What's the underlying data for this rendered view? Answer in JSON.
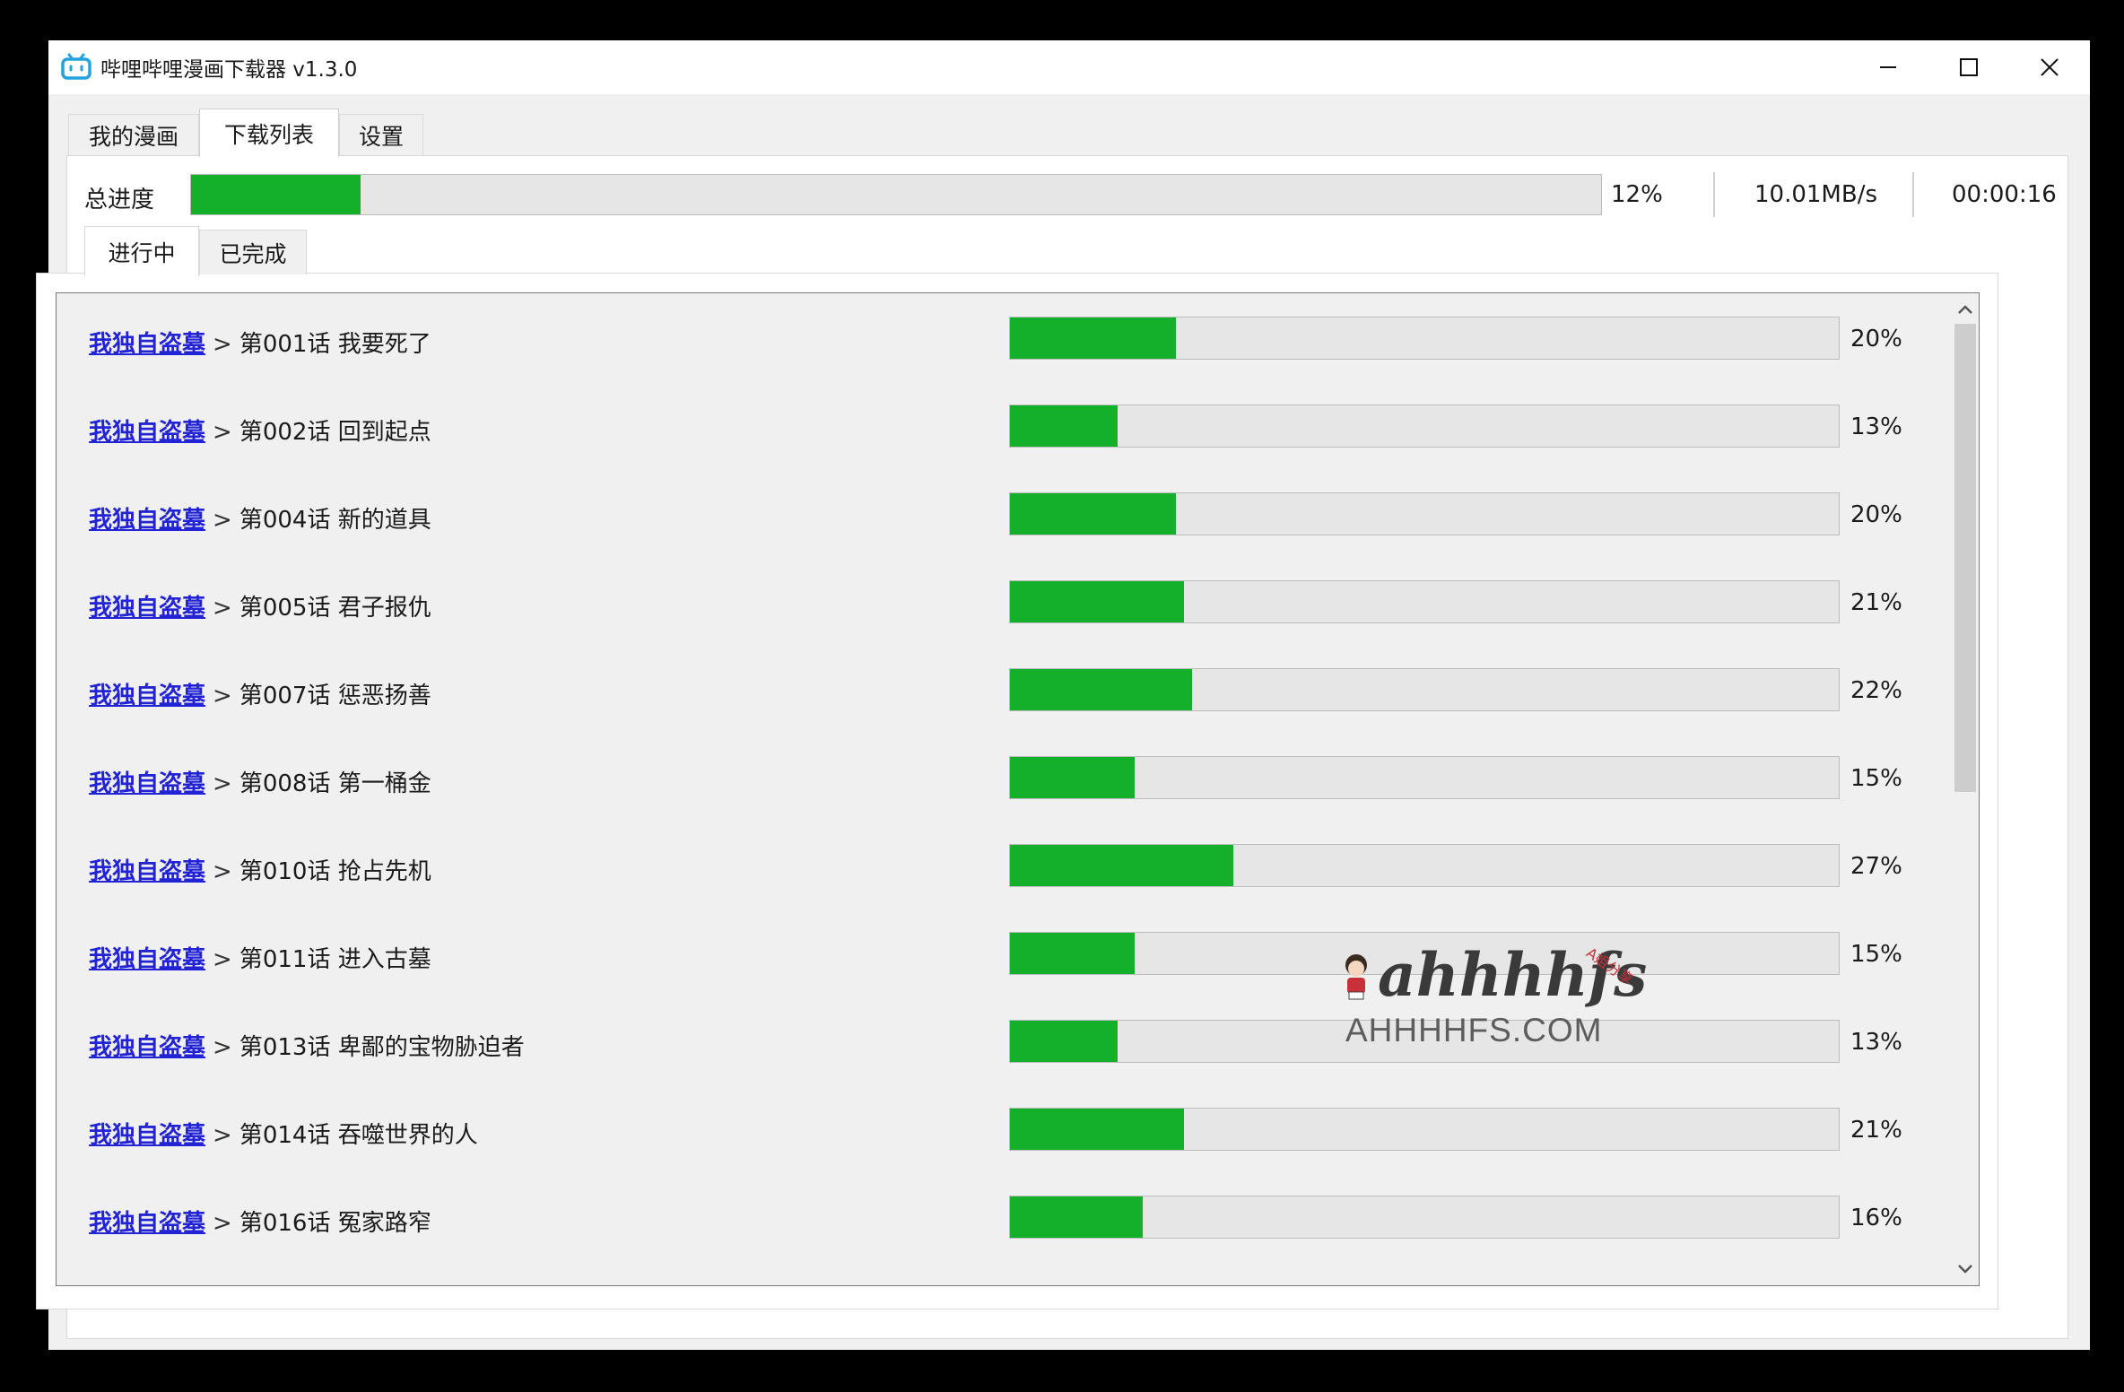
{
  "window": {
    "title": "哔哩哔哩漫画下载器 v1.3.0",
    "icon": "bilibili-tv-icon",
    "controls": {
      "minimize": "minimize-icon",
      "maximize": "maximize-icon",
      "close": "close-icon"
    }
  },
  "top_tabs": [
    {
      "label": "我的漫画",
      "active": false
    },
    {
      "label": "下载列表",
      "active": true
    },
    {
      "label": "设置",
      "active": false
    }
  ],
  "overall": {
    "label": "总进度",
    "progress": 12,
    "percent_text": "12%",
    "speed": "10.01MB/s",
    "elapsed": "00:00:16"
  },
  "sub_tabs": [
    {
      "label": "进行中",
      "active": true
    },
    {
      "label": "已完成",
      "active": false
    }
  ],
  "colors": {
    "progress_fill": "#13b02a",
    "progress_track": "#e6e6e6",
    "comic_link": "#2323d6"
  },
  "downloads": [
    {
      "comic": "我独自盗墓",
      "sep": ">",
      "episode": "第001话 我要死了",
      "progress": 20,
      "percent_text": "20%"
    },
    {
      "comic": "我独自盗墓",
      "sep": ">",
      "episode": "第002话 回到起点",
      "progress": 13,
      "percent_text": "13%"
    },
    {
      "comic": "我独自盗墓",
      "sep": ">",
      "episode": "第004话 新的道具",
      "progress": 20,
      "percent_text": "20%"
    },
    {
      "comic": "我独自盗墓",
      "sep": ">",
      "episode": "第005话 君子报仇",
      "progress": 21,
      "percent_text": "21%"
    },
    {
      "comic": "我独自盗墓",
      "sep": ">",
      "episode": "第007话 惩恶扬善",
      "progress": 22,
      "percent_text": "22%"
    },
    {
      "comic": "我独自盗墓",
      "sep": ">",
      "episode": "第008话 第一桶金",
      "progress": 15,
      "percent_text": "15%"
    },
    {
      "comic": "我独自盗墓",
      "sep": ">",
      "episode": "第010话 抢占先机",
      "progress": 27,
      "percent_text": "27%"
    },
    {
      "comic": "我独自盗墓",
      "sep": ">",
      "episode": "第011话 进入古墓",
      "progress": 15,
      "percent_text": "15%"
    },
    {
      "comic": "我独自盗墓",
      "sep": ">",
      "episode": "第013话 卑鄙的宝物胁迫者",
      "progress": 13,
      "percent_text": "13%"
    },
    {
      "comic": "我独自盗墓",
      "sep": ">",
      "episode": "第014话 吞噬世界的人",
      "progress": 21,
      "percent_text": "21%"
    },
    {
      "comic": "我独自盗墓",
      "sep": ">",
      "episode": "第016话 冤家路窄",
      "progress": 16,
      "percent_text": "16%"
    }
  ],
  "scrollbar": {
    "up": "chevron-up-icon",
    "down": "chevron-down-icon"
  },
  "watermark": {
    "script": "ahhhhfs",
    "badge": "A姐分享",
    "domain": "AHHHHFS.COM"
  }
}
